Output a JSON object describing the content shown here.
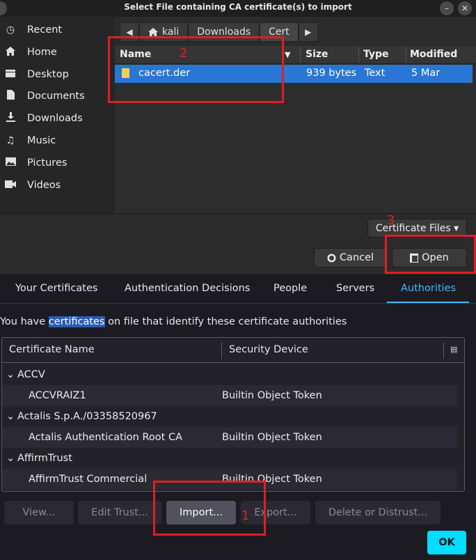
{
  "chooser": {
    "title": "Select File containing CA certificate(s) to import",
    "places": [
      {
        "label": "Recent",
        "icon": "clock-icon"
      },
      {
        "label": "Home",
        "icon": "home-icon"
      },
      {
        "label": "Desktop",
        "icon": "desktop-icon"
      },
      {
        "label": "Documents",
        "icon": "document-icon"
      },
      {
        "label": "Downloads",
        "icon": "download-icon"
      },
      {
        "label": "Music",
        "icon": "music-icon"
      },
      {
        "label": "Pictures",
        "icon": "picture-icon"
      },
      {
        "label": "Videos",
        "icon": "video-icon"
      }
    ],
    "path": [
      "kali",
      "Downloads",
      "Cert"
    ],
    "columns": {
      "name": "Name",
      "size": "Size",
      "type": "Type",
      "modified": "Modified"
    },
    "files": [
      {
        "name": "cacert.der",
        "size": "939 bytes",
        "type": "Text",
        "modified": "5 Mar"
      }
    ],
    "filter_label": "Certificate Files ▾",
    "cancel_label": "Cancel",
    "open_label": "Open"
  },
  "annotations": {
    "one": "1",
    "two": "2",
    "three": "3",
    "color": "#e01e24"
  },
  "manager": {
    "tabs": [
      "Your Certificates",
      "Authentication Decisions",
      "People",
      "Servers",
      "Authorities"
    ],
    "active_tab": "Authorities",
    "desc_before": "You have ",
    "desc_highlight": "certificates",
    "desc_after": " on file that identify these certificate authorities",
    "headers": {
      "name": "Certificate Name",
      "device": "Security Device"
    },
    "groups": [
      {
        "name": "ACCV",
        "items": [
          {
            "name": "ACCVRAIZ1",
            "device": "Builtin Object Token"
          }
        ]
      },
      {
        "name": "Actalis S.p.A./03358520967",
        "items": [
          {
            "name": "Actalis Authentication Root CA",
            "device": "Builtin Object Token"
          }
        ]
      },
      {
        "name": "AffirmTrust",
        "items": [
          {
            "name": "AffirmTrust Commercial",
            "device": "Builtin Object Token"
          }
        ]
      }
    ],
    "buttons": {
      "view": "View...",
      "edit": "Edit Trust...",
      "import": "Import...",
      "export": "Export...",
      "delete": "Delete or Distrust..."
    },
    "ok_label": "OK",
    "accent_color": "#00ddff"
  }
}
